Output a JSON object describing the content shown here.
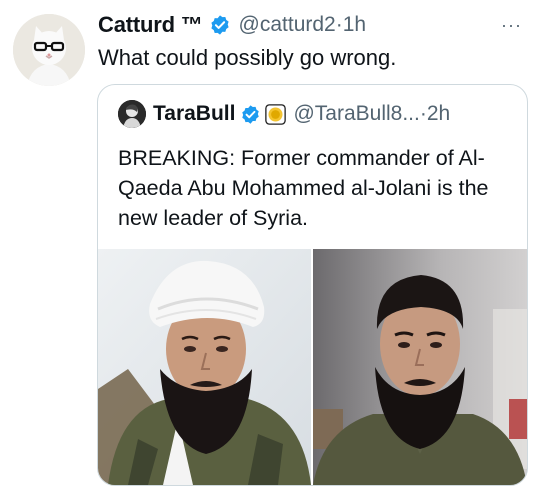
{
  "tweet": {
    "author_name": "Catturd ™",
    "handle": "@catturd2",
    "separator": "·",
    "time": "1h",
    "more": "···",
    "text": "What could possibly go wrong."
  },
  "quote": {
    "author_name": "TaraBull",
    "handle": "@TaraBull8...",
    "separator": "·",
    "time": "2h",
    "text": "BREAKING: Former commander of Al-Qaeda Abu Mohammed al-Jolani is the new leader of Syria."
  },
  "colors": {
    "verified_blue": "#1d9bf0",
    "gold_badge": "#f4c430",
    "secondary_text": "#536471",
    "border": "#cfd9de"
  }
}
